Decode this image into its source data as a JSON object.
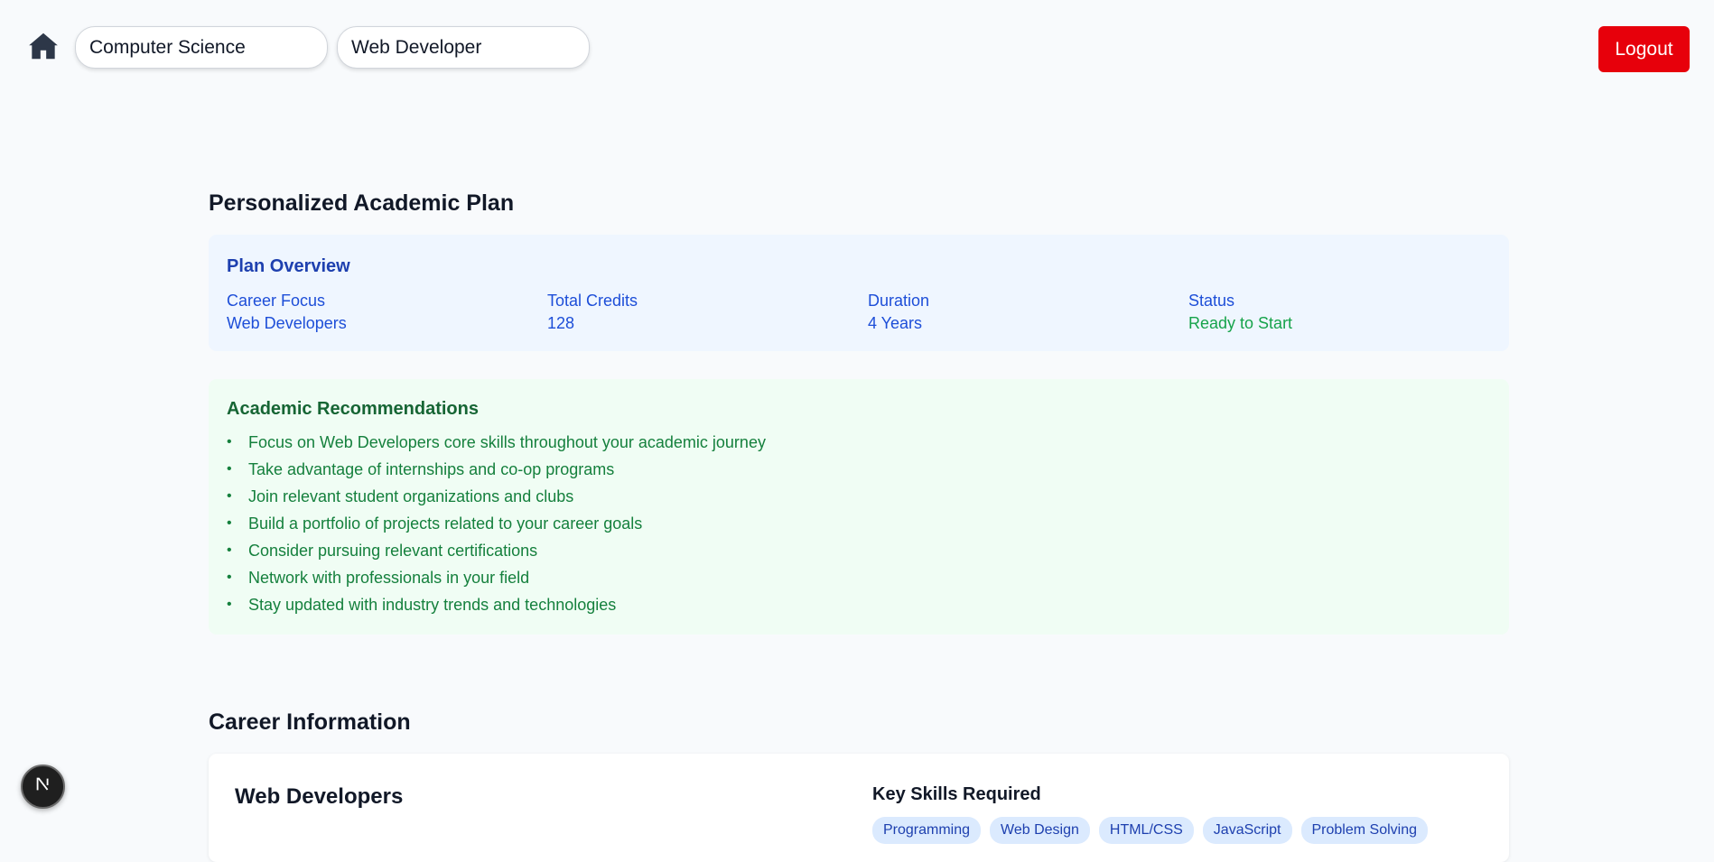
{
  "header": {
    "field_value": "Computer Science",
    "career_value": "Web Developer",
    "logout_label": "Logout"
  },
  "plan": {
    "title": "Personalized Academic Plan",
    "overview": {
      "heading": "Plan Overview",
      "items": [
        {
          "label": "Career Focus",
          "value": "Web Developers"
        },
        {
          "label": "Total Credits",
          "value": "128"
        },
        {
          "label": "Duration",
          "value": "4 Years"
        },
        {
          "label": "Status",
          "value": "Ready to Start"
        }
      ]
    },
    "recommendations": {
      "heading": "Academic Recommendations",
      "items": [
        "Focus on Web Developers core skills throughout your academic journey",
        "Take advantage of internships and co-op programs",
        "Join relevant student organizations and clubs",
        "Build a portfolio of projects related to your career goals",
        "Consider pursuing relevant certifications",
        "Network with professionals in your field",
        "Stay updated with industry trends and technologies"
      ]
    }
  },
  "career": {
    "title": "Career Information",
    "name": "Web Developers",
    "skills_heading": "Key Skills Required",
    "skills": [
      "Programming",
      "Web Design",
      "HTML/CSS",
      "JavaScript",
      "Problem Solving"
    ]
  },
  "colors": {
    "logout": "#e7000b",
    "overview_bg": "#eff6ff",
    "recs_bg": "#f0fdf4",
    "status_green": "#16a34a"
  },
  "icons": {
    "home": "home-icon",
    "next": "nextjs-logo-icon"
  }
}
